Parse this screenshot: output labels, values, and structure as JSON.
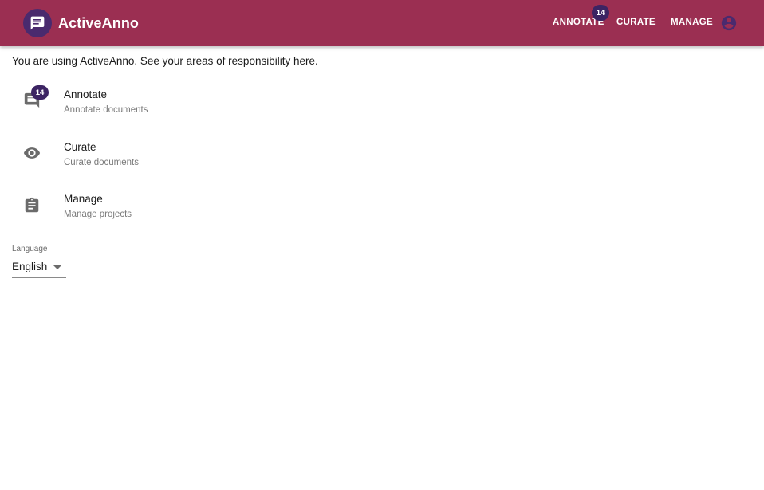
{
  "colors": {
    "appbar": "#9b2f52",
    "badge": "#3c2463",
    "logo": "#4a2a6e",
    "icon": "#6b6b6b"
  },
  "appbar": {
    "brand_icon": "chat-bubble-icon",
    "brand_name": "ActiveAnno",
    "nav": {
      "annotate_label": "ANNOTATE",
      "annotate_badge": "14",
      "curate_label": "CURATE",
      "manage_label": "MANAGE"
    },
    "account_icon": "account-circle-icon"
  },
  "main": {
    "intro": "You are using ActiveAnno. See your areas of responsibility here.",
    "items": [
      {
        "icon": "comment-icon",
        "badge": "14",
        "primary": "Annotate",
        "secondary": "Annotate documents"
      },
      {
        "icon": "eye-icon",
        "primary": "Curate",
        "secondary": "Curate documents"
      },
      {
        "icon": "clipboard-icon",
        "primary": "Manage",
        "secondary": "Manage projects"
      }
    ],
    "language": {
      "label": "Language",
      "value": "English"
    }
  }
}
